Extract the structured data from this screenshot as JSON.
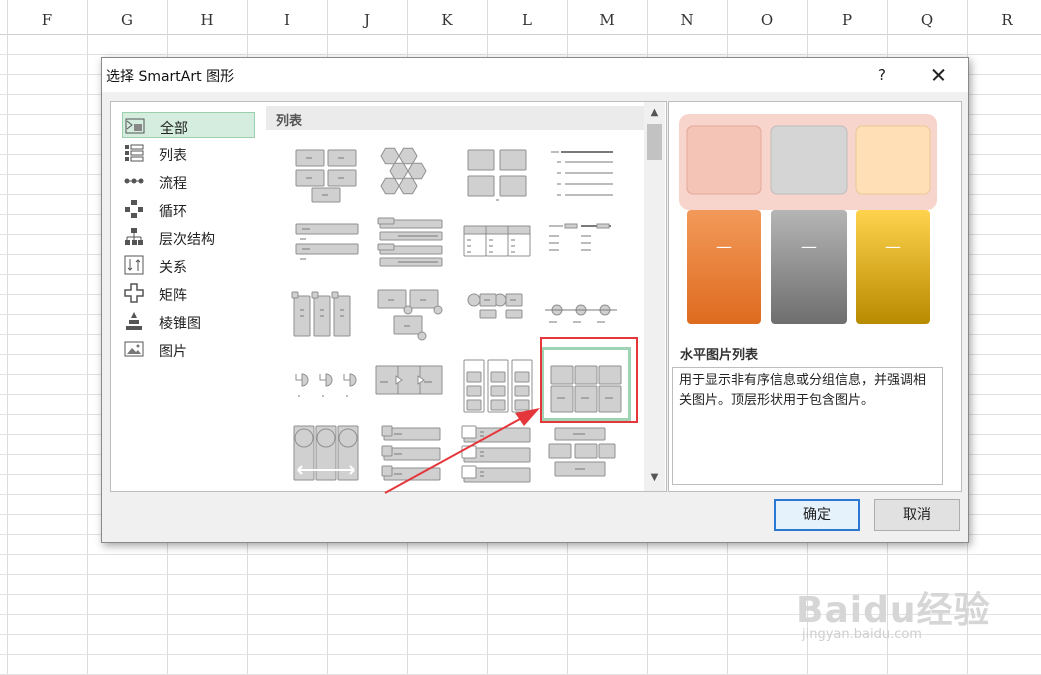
{
  "sheet": {
    "columns": [
      "F",
      "G",
      "H",
      "I",
      "J",
      "K",
      "L",
      "M",
      "N",
      "O",
      "P",
      "Q",
      "R"
    ]
  },
  "dialog": {
    "title": "选择 SmartArt 图形",
    "help_label": "?",
    "categories": [
      {
        "label": "全部",
        "icon": "all-layouts-icon"
      },
      {
        "label": "列表",
        "icon": "list-icon"
      },
      {
        "label": "流程",
        "icon": "process-icon"
      },
      {
        "label": "循环",
        "icon": "cycle-icon"
      },
      {
        "label": "层次结构",
        "icon": "hierarchy-icon"
      },
      {
        "label": "关系",
        "icon": "relationship-icon"
      },
      {
        "label": "矩阵",
        "icon": "matrix-icon"
      },
      {
        "label": "棱锥图",
        "icon": "pyramid-icon"
      },
      {
        "label": "图片",
        "icon": "picture-icon"
      }
    ],
    "selected_category": "全部",
    "layouts_header": "列表",
    "preview": {
      "name": "水平图片列表",
      "description": "用于显示非有序信息或分组信息，并强调相关图片。顶层形状用于包含图片。",
      "dash": "—",
      "colors": {
        "orange_top": "#f4c4b6",
        "gray_top": "#d5d5d5",
        "yellow_top": "#ffdfb5",
        "orange_bar": "#de6b1e",
        "gray_bar": "#8a8a8a",
        "yellow_bar": "#e0ab12",
        "band": "#f8d5cc"
      }
    },
    "ok_label": "确定",
    "cancel_label": "取消"
  },
  "watermark": {
    "logo": "Baidu经验",
    "url": "jingyan.baidu.com"
  },
  "colors": {
    "annotation_red": "#e5363b",
    "selection_green": "#9fd3b4",
    "category_selected": "#d4edde"
  }
}
